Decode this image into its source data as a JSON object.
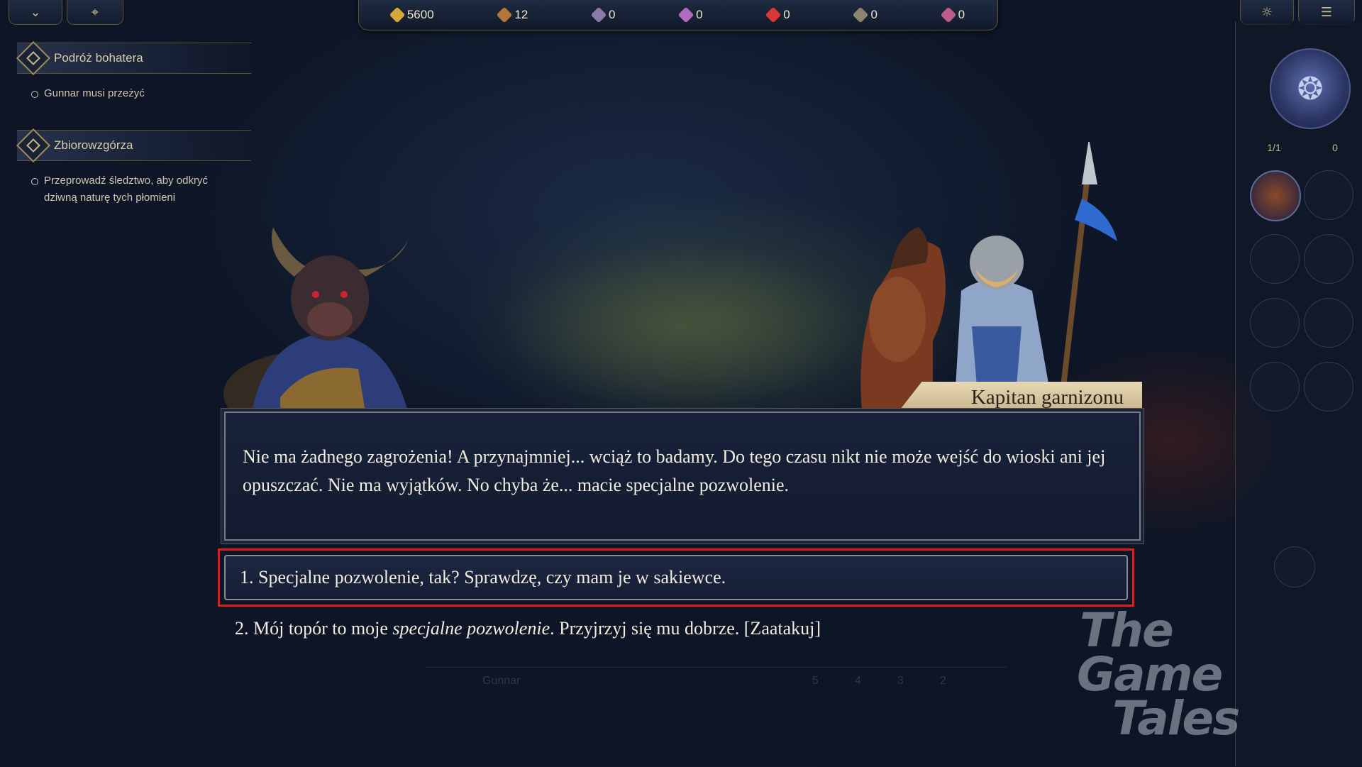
{
  "resources": [
    {
      "icon": "gold-icon",
      "value": "5600",
      "color": "#d8a93a"
    },
    {
      "icon": "wood-icon",
      "value": "12",
      "color": "#b4773a"
    },
    {
      "icon": "ore-icon",
      "value": "0",
      "color": "#8a7aa8"
    },
    {
      "icon": "crystal-icon",
      "value": "0",
      "color": "#b06ac0"
    },
    {
      "icon": "mercury-icon",
      "value": "0",
      "color": "#d83838"
    },
    {
      "icon": "dust-icon",
      "value": "0",
      "color": "#8c8470"
    },
    {
      "icon": "gem-icon",
      "value": "0",
      "color": "#c05a8a"
    }
  ],
  "quests": [
    {
      "title": "Podróż bohatera",
      "objectives": [
        "Gunnar musi przeżyć"
      ]
    },
    {
      "title": "Zbiorowzgórza",
      "objectives": [
        "Przeprowadź śledztwo, aby odkryć dziwną naturę tych płomieni"
      ]
    }
  ],
  "right_panel": {
    "army_count": "1/1",
    "town_count": "0"
  },
  "dialog": {
    "speaker": "Kapitan garnizonu",
    "text": "Nie ma żadnego zagrożenia! A przynajmniej... wciąż to badamy. Do tego czasu nikt nie może wejść do wioski ani jej opuszczać. Nie ma wyjątków. No chyba że... macie specjalne pozwolenie.",
    "choice_1": "1. Specjalne pozwolenie, tak? Sprawdzę, czy mam je w sakiewce.",
    "choice_2_prefix": "2. Mój topór to moje ",
    "choice_2_italic": "specjalne pozwolenie",
    "choice_2_suffix": ". Przyjrzyj się mu dobrze. [Zaatakuj]"
  },
  "hud": {
    "hero_name": "Gunnar",
    "stats": [
      "5",
      "4",
      "3",
      "2"
    ]
  },
  "watermark": [
    "The",
    "Game",
    "Tales"
  ],
  "accent": {
    "highlight": "#e41b1b",
    "gold": "#c9b98a"
  }
}
